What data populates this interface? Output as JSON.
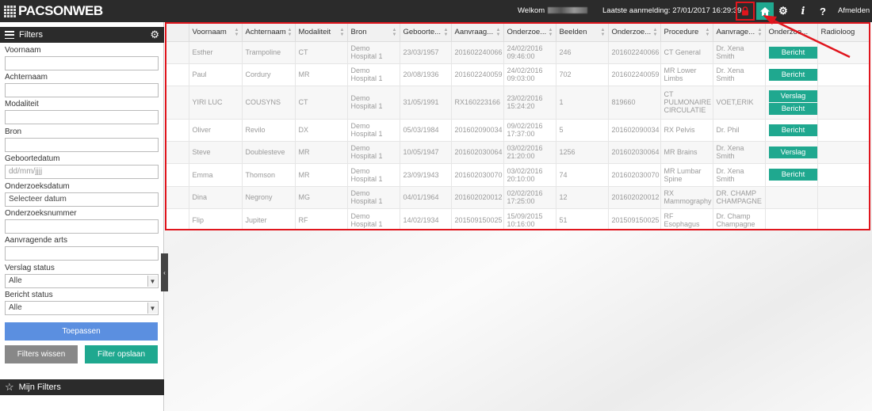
{
  "topbar": {
    "logo": "PACSONWEB",
    "welcome": "Welkom",
    "last_login": "Laatste aanmelding: 27/01/2017 16:29:39",
    "logout": "Afmelden",
    "icons": [
      "lock-icon",
      "home-icon",
      "gear-icon",
      "info-icon",
      "help-icon"
    ]
  },
  "sidebar": {
    "filters_title": "Filters",
    "fields": [
      {
        "label": "Voornaam",
        "value": ""
      },
      {
        "label": "Achternaam",
        "value": ""
      },
      {
        "label": "Modaliteit",
        "value": ""
      },
      {
        "label": "Bron",
        "value": ""
      },
      {
        "label": "Geboortedatum",
        "placeholder": "dd/mm/jjjj"
      },
      {
        "label": "Onderzoeksdatum",
        "value": "Selecteer datum"
      },
      {
        "label": "Onderzoeksnummer",
        "value": ""
      },
      {
        "label": "Aanvragende arts",
        "value": ""
      },
      {
        "label": "Verslag status",
        "value": "Alle"
      },
      {
        "label": "Bericht status",
        "value": "Alle"
      }
    ],
    "apply": "Toepassen",
    "clear": "Filters wissen",
    "save": "Filter opslaan",
    "my_filters": "Mijn Filters"
  },
  "table": {
    "columns": [
      "Voornaam",
      "Achternaam",
      "Modaliteit",
      "Bron",
      "Geboorte...",
      "Aanvraag...",
      "Onderzoe...",
      "Beelden",
      "Onderzoe...",
      "Procedure",
      "Aanvrage...",
      "Onderzoe...",
      "Radioloog"
    ],
    "rows": [
      {
        "first": "Esther",
        "last": "Trampoline",
        "mod": "CT",
        "src": "Demo Hospital 1",
        "birth": "23/03/1957",
        "req": "201602240066",
        "date": "24/02/2016 09:46:00",
        "images": "246",
        "exam": "201602240066",
        "proc": "CT General",
        "doctor": "Dr. Xena Smith",
        "actions": [
          "Bericht"
        ],
        "rad": ""
      },
      {
        "first": "Paul",
        "last": "Cordury",
        "mod": "MR",
        "src": "Demo Hospital 1",
        "birth": "20/08/1936",
        "req": "201602240059",
        "date": "24/02/2016 09:03:00",
        "images": "702",
        "exam": "201602240059",
        "proc": "MR Lower Limbs",
        "doctor": "Dr. Xena Smith",
        "actions": [
          "Bericht"
        ],
        "rad": ""
      },
      {
        "first": "YIRI LUC",
        "last": "COUSYNS",
        "mod": "CT",
        "src": "Demo Hospital 1",
        "birth": "31/05/1991",
        "req": "RX160223166",
        "date": "23/02/2016 15:24:20",
        "images": "1",
        "exam": "819660",
        "proc": "CT PULMONAIRE CIRCULATIE",
        "doctor": "VOET,ERIK",
        "actions": [
          "Verslag",
          "Bericht"
        ],
        "rad": ""
      },
      {
        "first": "Oliver",
        "last": "Revilo",
        "mod": "DX",
        "src": "Demo Hospital 1",
        "birth": "05/03/1984",
        "req": "201602090034",
        "date": "09/02/2016 17:37:00",
        "images": "5",
        "exam": "201602090034",
        "proc": "RX Pelvis",
        "doctor": "Dr. Phil",
        "actions": [
          "Bericht"
        ],
        "rad": ""
      },
      {
        "first": "Steve",
        "last": "Doublesteve",
        "mod": "MR",
        "src": "Demo Hospital 1",
        "birth": "10/05/1947",
        "req": "201602030064",
        "date": "03/02/2016 21:20:00",
        "images": "1256",
        "exam": "201602030064",
        "proc": "MR Brains",
        "doctor": "Dr. Xena Smith",
        "actions": [
          "Verslag"
        ],
        "rad": ""
      },
      {
        "first": "Emma",
        "last": "Thomson",
        "mod": "MR",
        "src": "Demo Hospital 1",
        "birth": "23/09/1943",
        "req": "201602030070",
        "date": "03/02/2016 20:10:00",
        "images": "74",
        "exam": "201602030070",
        "proc": "MR Lumbar Spine",
        "doctor": "Dr. Xena Smith",
        "actions": [
          "Bericht"
        ],
        "rad": ""
      },
      {
        "first": "Dina",
        "last": "Negrony",
        "mod": "MG",
        "src": "Demo Hospital 1",
        "birth": "04/01/1964",
        "req": "201602020012",
        "date": "02/02/2016 17:25:00",
        "images": "12",
        "exam": "201602020012",
        "proc": "RX Mammography",
        "doctor": "DR. CHAMP CHAMPAGNE",
        "actions": [],
        "rad": ""
      },
      {
        "first": "Flip",
        "last": "Jupiter",
        "mod": "RF",
        "src": "Demo Hospital 1",
        "birth": "14/02/1934",
        "req": "201509150025",
        "date": "15/09/2015 10:16:00",
        "images": "51",
        "exam": "201509150025",
        "proc": "RF Esophagus",
        "doctor": "Dr. Champ Champagne",
        "actions": [],
        "rad": ""
      }
    ]
  },
  "colors": {
    "accent": "#1fa88f",
    "apply": "#5b8fe0",
    "highlight": "#e0151d",
    "bar": "#2b2b2b"
  }
}
